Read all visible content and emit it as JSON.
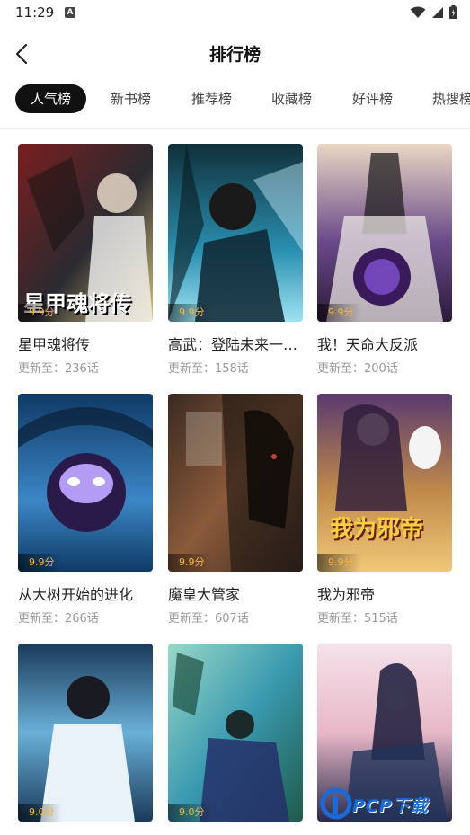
{
  "status_bar": {
    "time": "11:29",
    "notification_badge": "A"
  },
  "header": {
    "title": "排行榜"
  },
  "tabs": [
    {
      "label": "人气榜",
      "active": true
    },
    {
      "label": "新书榜"
    },
    {
      "label": "推荐榜"
    },
    {
      "label": "收藏榜"
    },
    {
      "label": "好评榜"
    },
    {
      "label": "热搜榜"
    }
  ],
  "comics": [
    {
      "title": "星甲魂将传",
      "update": "更新至：236话",
      "score": "9.9分",
      "cover_text": "星甲魂将传",
      "colors": [
        "#2a2a30",
        "#7a1e1e",
        "#d8c07a"
      ]
    },
    {
      "title": "高武：登陆未来一…",
      "update": "更新至：158话",
      "score": "9.9分",
      "cover_text": "",
      "colors": [
        "#10303a",
        "#2a8fb0",
        "#9fe3f2"
      ]
    },
    {
      "title": "我！天命大反派",
      "update": "更新至：200话",
      "score": "9.9分",
      "cover_text": "",
      "colors": [
        "#e9d7c3",
        "#6a4a8a",
        "#2b1a3a"
      ]
    },
    {
      "title": "从大树开始的进化",
      "update": "更新至：266话",
      "score": "9.9分",
      "cover_text": "",
      "colors": [
        "#0f3a66",
        "#3c86c6",
        "#b49cf5"
      ]
    },
    {
      "title": "魔皇大管家",
      "update": "更新至：607话",
      "score": "9.9分",
      "cover_text": "",
      "colors": [
        "#3a2a22",
        "#8a5a3a",
        "#c04040"
      ]
    },
    {
      "title": "我为邪帝",
      "update": "更新至：515话",
      "score": "9.9分",
      "cover_text": "我为邪帝",
      "colors": [
        "#5a3a70",
        "#c08a4a",
        "#f0c878"
      ]
    },
    {
      "title": "",
      "update": "",
      "score": "9.0分",
      "cover_text": "",
      "colors": [
        "#1a3a5a",
        "#6ab0d8",
        "#e8f2f8"
      ]
    },
    {
      "title": "",
      "update": "",
      "score": "9.0分",
      "cover_text": "",
      "colors": [
        "#1f5a4a",
        "#3a9ab0",
        "#9ad8c8"
      ]
    },
    {
      "title": "",
      "update": "",
      "score": "",
      "cover_text": "",
      "colors": [
        "#2a2a4a",
        "#e8b8c8",
        "#f5e2ea"
      ]
    }
  ],
  "watermark": {
    "text": "PCP下载"
  }
}
